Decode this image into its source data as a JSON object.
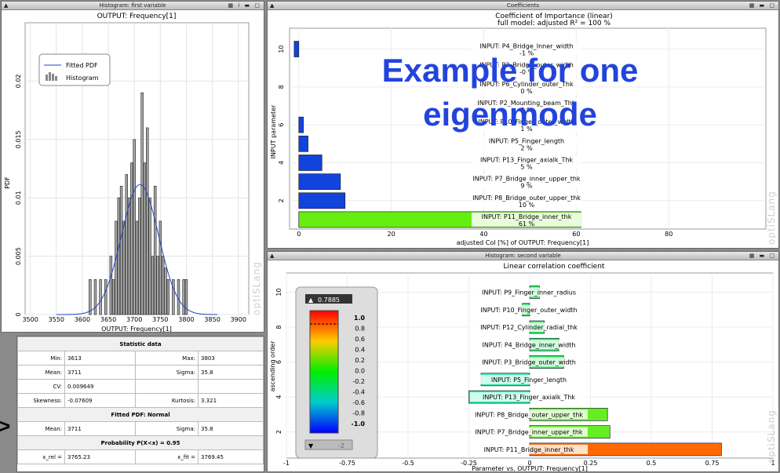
{
  "histogram_panel": {
    "window_title": "Histogram: first variable",
    "plot_title": "OUTPUT: Frequency[1]",
    "xlabel": "OUTPUT: Frequency[1]",
    "ylabel": "PDF",
    "legend_fitted": "Fitted PDF",
    "legend_histogram": "Histogram",
    "watermark": "optiSLang",
    "x_ticks": [
      "3500",
      "3550",
      "3600",
      "3650",
      "3700",
      "3750",
      "3800",
      "3850",
      "3900"
    ],
    "y_ticks": [
      "0",
      "0.005",
      "0.01",
      "0.015",
      "0.02"
    ]
  },
  "stats": {
    "title": "Statistic data",
    "min_label": "Min:",
    "min": "3613",
    "max_label": "Max:",
    "max": "3803",
    "mean_label": "Mean:",
    "mean": "3711",
    "sigma_label": "Sigma:",
    "sigma": "35.8",
    "cv_label": "CV:",
    "cv": "0.009649",
    "skew_label": "Skewness:",
    "skew": "-0.07609",
    "kurt_label": "Kurtosis:",
    "kurt": "3.321",
    "fitted_title": "Fitted PDF: Normal",
    "fit_mean_label": "Mean:",
    "fit_mean": "3711",
    "fit_sigma_label": "Sigma:",
    "fit_sigma": "35.8",
    "prob_title": "Probability P(X<x) = 0.95",
    "xrel_label": "x_rel =",
    "xrel": "3765.23",
    "xfit_label": "x_fit =",
    "xfit": "3769.45"
  },
  "coi_panel": {
    "window_title": "Coefficients",
    "title_line1": "Coefficient of Importance (linear)",
    "title_line2": "full model: adjusted R² =  100 %",
    "xlabel": "adjusted CoI [%] of OUTPUT: Frequency[1]",
    "ylabel": "INPUT parameter",
    "x_ticks": [
      "0",
      "20",
      "40",
      "60",
      "80"
    ],
    "y_ticks": [
      "2",
      "4",
      "6",
      "8",
      "10"
    ],
    "watermark": "optiSLang"
  },
  "corr_panel": {
    "window_title": "Histogram: second variable",
    "title": "Linear correlation coefficient",
    "xlabel": "Parameter vs. OUTPUT: Frequency[1]",
    "ylabel": "ascending order",
    "x_ticks": [
      "-1",
      "-0.75",
      "-0.5",
      "-0.25",
      "0",
      "0.25",
      "0.5",
      "0.75",
      "1"
    ],
    "y_ticks": [
      "2",
      "4",
      "6",
      "8",
      "10"
    ],
    "watermark": "optiSLang",
    "colorbar_top": "0.7885",
    "colorbar_bottom": "-2",
    "colorbar_ticks": [
      "1.0",
      "0.8",
      "0.6",
      "0.4",
      "0.2",
      "0.0",
      "-0.2",
      "-0.4",
      "-0.6",
      "-0.8",
      "-1.0"
    ]
  },
  "overlay_text": {
    "line1": "Example for one",
    "line2": "eigenmode"
  },
  "left_arrow": ">",
  "chart_data": [
    {
      "type": "bar",
      "title": "OUTPUT: Frequency[1]",
      "xlabel": "OUTPUT: Frequency[1]",
      "ylabel": "PDF",
      "xlim": [
        3490,
        3920
      ],
      "ylim": [
        0,
        0.025
      ],
      "bin_centers": [
        3615,
        3625,
        3635,
        3645,
        3655,
        3660,
        3665,
        3670,
        3675,
        3680,
        3685,
        3690,
        3695,
        3700,
        3705,
        3710,
        3715,
        3720,
        3725,
        3730,
        3735,
        3740,
        3745,
        3750,
        3755,
        3760,
        3765,
        3775,
        3785,
        3795,
        3800
      ],
      "values": [
        0.003,
        0.003,
        0.003,
        0.003,
        0.005,
        0.003,
        0.008,
        0.01,
        0.011,
        0.008,
        0.012,
        0.01,
        0.013,
        0.015,
        0.008,
        0.01,
        0.019,
        0.013,
        0.016,
        0.01,
        0.005,
        0.011,
        0.005,
        0.008,
        0.005,
        0.004,
        0.003,
        0.003,
        0.003,
        0.003,
        0.003
      ],
      "fitted_pdf": {
        "mean": 3711,
        "sigma": 35.8
      },
      "legend": [
        "Fitted PDF",
        "Histogram"
      ],
      "colors": {
        "bar": "#a8a8a8",
        "fit": "#2244cc"
      }
    },
    {
      "type": "bar",
      "orientation": "horizontal",
      "title": "Coefficient of Importance (linear)",
      "xlabel": "adjusted CoI [%] of OUTPUT: Frequency[1]",
      "ylabel": "INPUT parameter",
      "xlim": [
        -2,
        101
      ],
      "categories": [
        "INPUT: P11_Bridge_inner_thk",
        "INPUT: P8_Bridge_outer_upper_thk",
        "INPUT: P7_Bridge_inner_upper_thk",
        "INPUT: P13_Finger_axialk_Thk",
        "INPUT: P5_Finger_length",
        "INPUT: P10_Finger_outer_width",
        "INPUT: P2_Mounting_beam_Thk",
        "INPUT: P6_Cylinder_outer_Thk",
        "INPUT: P3_Bridge_outer_width",
        "INPUT: P4_Bridge_Inner_width"
      ],
      "values": [
        61,
        10,
        9,
        5,
        2,
        1,
        0,
        0,
        0,
        -1
      ],
      "value_labels": [
        "61 %",
        "10 %",
        "9 %",
        "5 %",
        "2 %",
        "1 %",
        "0 %",
        "0 %",
        "-0 %",
        "-1 %"
      ]
    },
    {
      "type": "bar",
      "orientation": "horizontal",
      "title": "Linear correlation coefficient",
      "xlabel": "Parameter vs. OUTPUT: Frequency[1]",
      "ylabel": "ascending order",
      "xlim": [
        -1,
        1
      ],
      "categories": [
        "INPUT: P11_Bridge_inner_thk",
        "INPUT: P7_Bridge_inner_upper_thk",
        "INPUT: P8_Bridge_outer_upper_thk",
        "INPUT: P13_Finger_axialk_Thk",
        "INPUT: P5_Finger_length",
        "INPUT: P3_Bridge_outer_width",
        "INPUT: P4_Bridge_inner_width",
        "INPUT: P12_Cylinder_radial_thk",
        "INPUT: P10_Finger_outer_width",
        "INPUT: P9_Finger_inner_radius"
      ],
      "values": [
        0.7885,
        0.33,
        0.32,
        -0.25,
        -0.2,
        0.14,
        0.12,
        0.06,
        -0.03,
        0.04
      ]
    }
  ]
}
